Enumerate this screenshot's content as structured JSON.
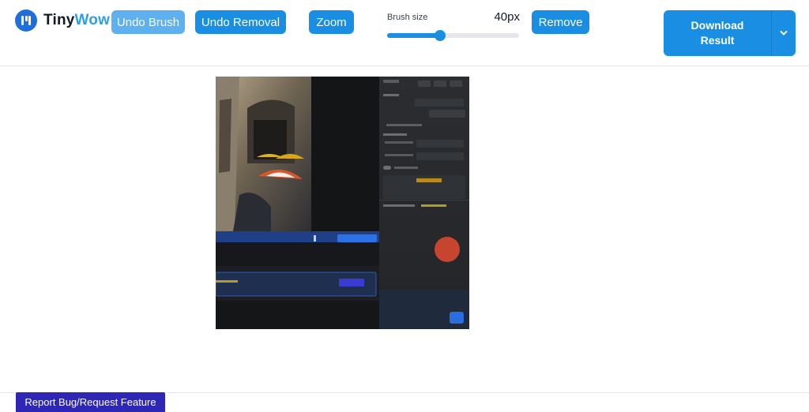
{
  "brand": {
    "name_part1": "Tiny",
    "name_part2": "Wow"
  },
  "toolbar": {
    "undo_brush_label": "Undo Brush",
    "undo_removal_label": "Undo Removal",
    "zoom_label": "Zoom",
    "remove_label": "Remove"
  },
  "brush": {
    "label": "Brush size",
    "value_text": "40px",
    "level": 0.4
  },
  "download": {
    "line1": "Download",
    "line2": "Result",
    "dropdown_icon": "chevron-down-icon"
  },
  "footer": {
    "report_label": "Report Bug/Request Feature"
  },
  "colors": {
    "accent": "#1a8ee3",
    "accent_light": "#5fb0ee",
    "report": "#2e27b5",
    "logo": "#1e6fd9",
    "logo_text_accent": "#2f9ee8"
  }
}
